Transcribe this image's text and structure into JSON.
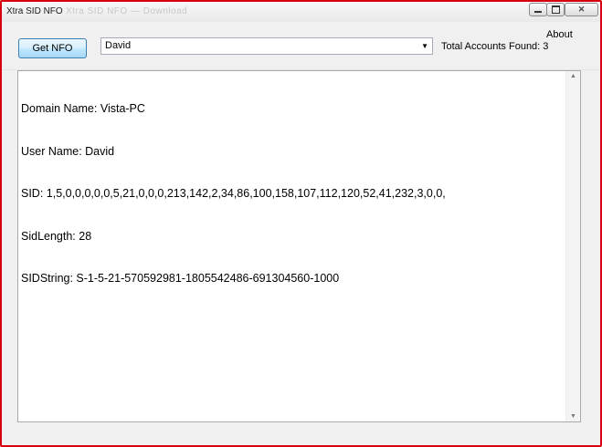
{
  "window": {
    "title": "Xtra SID NFO",
    "title_ghost": "Xtra SID NFO — Download",
    "close_glyph": "✕"
  },
  "toolbar": {
    "get_nfo_label": "Get NFO",
    "account_selected": "David",
    "total_label": "Total Accounts Found:",
    "total_count": "3",
    "about_label": "About"
  },
  "output": {
    "lines": [
      "Domain Name: Vista-PC",
      "User Name: David",
      "SID: 1,5,0,0,0,0,0,5,21,0,0,0,213,142,2,34,86,100,158,107,112,120,52,41,232,3,0,0,",
      "SidLength: 28",
      "SIDString: S-1-5-21-570592981-1805542486-691304560-1000"
    ]
  },
  "icons": {
    "dropdown": "chevron-down-icon",
    "scroll_up": "scroll-up-icon",
    "scroll_down": "scroll-down-icon"
  },
  "colors": {
    "frame_red": "#d8000f",
    "button_border": "#3c7fb1"
  }
}
